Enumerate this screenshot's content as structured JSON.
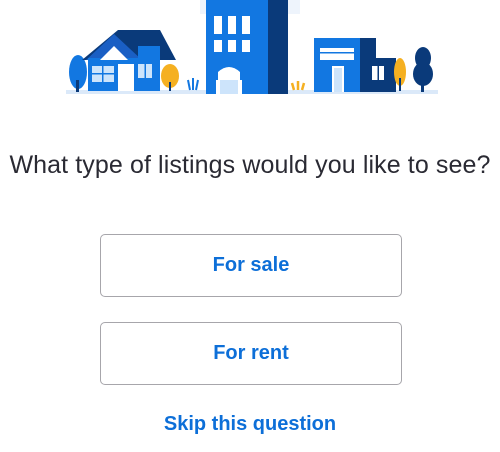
{
  "illustration": {
    "icon": "houses-illustration",
    "colors": {
      "primary_blue": "#1277e1",
      "dark_navy": "#0a3a7a",
      "light_blue": "#cde4fb",
      "orange": "#f5b021",
      "ground": "#dbe9f9"
    }
  },
  "question": {
    "text": "What type of listings would you like to see?"
  },
  "options": [
    {
      "label": "For sale"
    },
    {
      "label": "For rent"
    }
  ],
  "skip": {
    "label": "Skip this question"
  },
  "accent_color": "#0d6fd8"
}
